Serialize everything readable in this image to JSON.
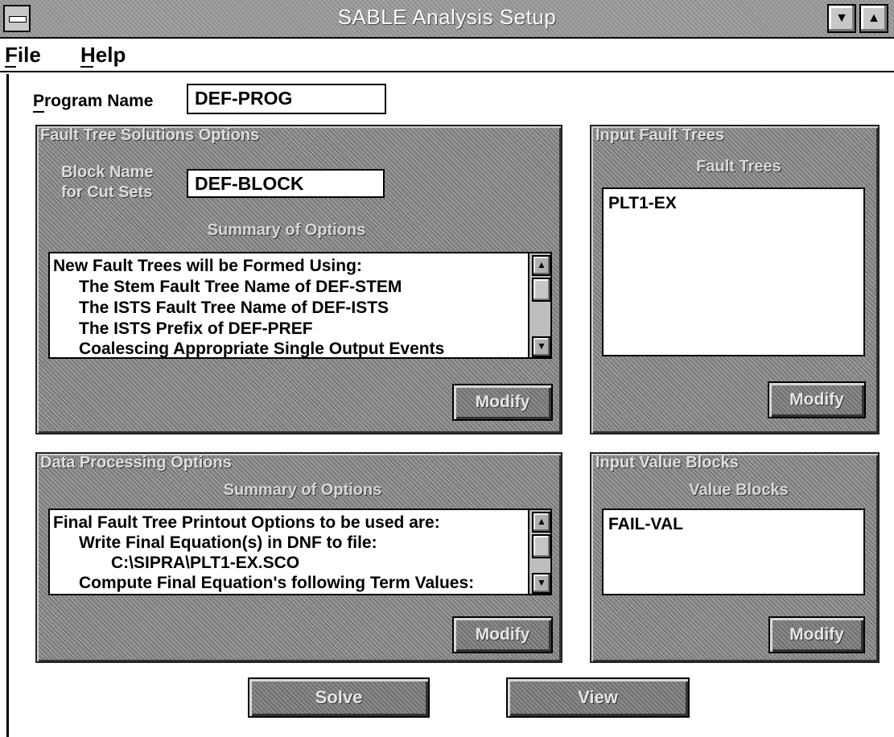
{
  "window": {
    "title": "SABLE Analysis Setup"
  },
  "menu": {
    "file": "File",
    "help": "Help"
  },
  "program": {
    "label": "Program Name",
    "value": "DEF-PROG"
  },
  "fault_tree_solutions": {
    "title": "Fault Tree Solutions Options",
    "block_label_line1": "Block Name",
    "block_label_line2": "for Cut Sets",
    "block_value": "DEF-BLOCK",
    "summary_label": "Summary of Options",
    "lines": [
      "New Fault Trees will be Formed Using:",
      "The Stem Fault Tree Name of DEF-STEM",
      "The ISTS Fault Tree Name of DEF-ISTS",
      "The ISTS Prefix of DEF-PREF",
      "Coalescing Appropriate Single Output Events"
    ],
    "modify": "Modify"
  },
  "input_fault_trees": {
    "title": "Input Fault Trees",
    "header": "Fault Trees",
    "items": [
      "PLT1-EX"
    ],
    "modify": "Modify"
  },
  "data_processing": {
    "title": "Data Processing Options",
    "summary_label": "Summary of Options",
    "lines": [
      "Final Fault Tree Printout Options to be used are:",
      "Write Final Equation(s) in DNF to file:",
      "C:\\SIPRA\\PLT1-EX.SCO",
      "Compute Final Equation's following Term Values:"
    ],
    "modify": "Modify"
  },
  "input_value_blocks": {
    "title": "Input Value Blocks",
    "header": "Value Blocks",
    "items": [
      "FAIL-VAL"
    ],
    "modify": "Modify"
  },
  "actions": {
    "solve": "Solve",
    "view": "View"
  }
}
